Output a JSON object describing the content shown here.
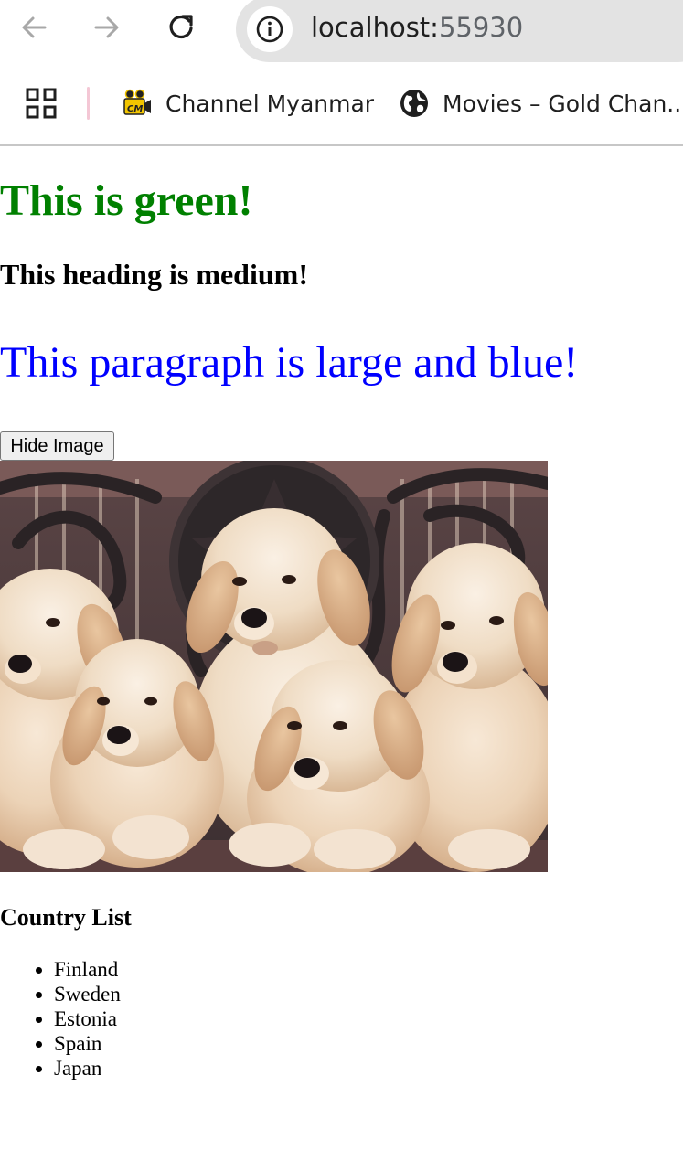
{
  "browser": {
    "url_host": "localhost:",
    "url_port": "55930",
    "bookmarks": [
      {
        "label": "Channel Myanmar",
        "icon": "channel-myanmar-logo-icon"
      },
      {
        "label": "Movies – Gold Chan...",
        "icon": "globe-icon"
      }
    ],
    "icons": [
      "back-arrow-icon",
      "forward-arrow-icon",
      "reload-icon",
      "site-info-icon",
      "apps-grid-icon"
    ]
  },
  "page": {
    "heading_green": "This is green!",
    "heading_green_color": "#008000",
    "heading_medium": "This heading is medium!",
    "paragraph_blue": "This paragraph is large and blue!",
    "paragraph_blue_color": "#0000ff",
    "hide_button_label": "Hide Image",
    "country_list_title": "Country List",
    "countries": [
      "Finland",
      "Sweden",
      "Estonia",
      "Spain",
      "Japan"
    ]
  }
}
